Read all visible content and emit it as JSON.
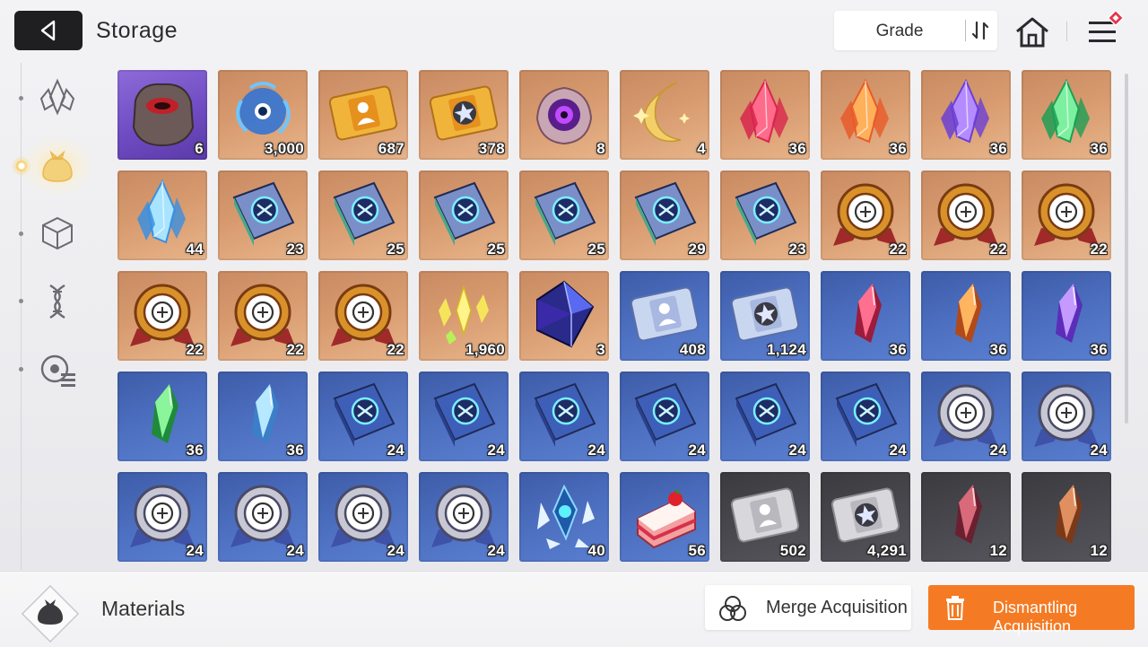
{
  "header": {
    "title": "Storage",
    "grade_label": "Grade"
  },
  "sidebar": {
    "tabs": [
      {
        "icon": "crystal-icon",
        "active": false
      },
      {
        "icon": "pouch-icon",
        "active": true
      },
      {
        "icon": "cube-icon",
        "active": false
      },
      {
        "icon": "dna-icon",
        "active": false
      },
      {
        "icon": "list-badge-icon",
        "active": false
      }
    ]
  },
  "footer": {
    "category_label": "Materials",
    "merge_label": "Merge Acquisition",
    "dismantle_label": "Dismantling Acquisition"
  },
  "colors": {
    "accent": "#f47b24",
    "grade_purple": "#7a55c8",
    "grade_orange": "#d99a6c",
    "grade_blue": "#4a6cbf",
    "grade_gray": "#45454b"
  },
  "items": [
    {
      "name": "dark-rock-item",
      "grade": "purple",
      "icon": "rock",
      "qty": "6"
    },
    {
      "name": "blue-spirit-item",
      "grade": "orange",
      "icon": "spirit",
      "qty": "3,000"
    },
    {
      "name": "gold-profile-ticket-item",
      "grade": "orange",
      "icon": "ticket-profile",
      "qty": "687"
    },
    {
      "name": "gold-star-ticket-item",
      "grade": "orange",
      "icon": "ticket-star",
      "qty": "378"
    },
    {
      "name": "eye-rock-item",
      "grade": "orange",
      "icon": "eye",
      "qty": "8"
    },
    {
      "name": "moon-feather-item",
      "grade": "orange",
      "icon": "moon",
      "qty": "4"
    },
    {
      "name": "red-crystal-item",
      "grade": "orange",
      "icon": "crystal-red",
      "qty": "36"
    },
    {
      "name": "orange-crystal-item",
      "grade": "orange",
      "icon": "crystal-orange",
      "qty": "36"
    },
    {
      "name": "purple-crystal-item",
      "grade": "orange",
      "icon": "crystal-purple",
      "qty": "36"
    },
    {
      "name": "green-crystal-item",
      "grade": "orange",
      "icon": "crystal-green",
      "qty": "36"
    },
    {
      "name": "blue-crystal-item",
      "grade": "orange",
      "icon": "crystal-blue",
      "qty": "44"
    },
    {
      "name": "sword-book-item",
      "grade": "orange",
      "icon": "book",
      "qty": "23"
    },
    {
      "name": "shield-book-item",
      "grade": "orange",
      "icon": "book",
      "qty": "25"
    },
    {
      "name": "eye-book-item",
      "grade": "orange",
      "icon": "book",
      "qty": "25"
    },
    {
      "name": "wing-book-item",
      "grade": "orange",
      "icon": "book",
      "qty": "25"
    },
    {
      "name": "bolt-book-item",
      "grade": "orange",
      "icon": "book",
      "qty": "29"
    },
    {
      "name": "target-book-item",
      "grade": "orange",
      "icon": "book",
      "qty": "23"
    },
    {
      "name": "sword-medal-item",
      "grade": "orange",
      "icon": "medal-gold",
      "qty": "22"
    },
    {
      "name": "shield-medal-item",
      "grade": "orange",
      "icon": "medal-gold",
      "qty": "22"
    },
    {
      "name": "eye-medal-item",
      "grade": "orange",
      "icon": "medal-gold",
      "qty": "22"
    },
    {
      "name": "wing-medal-item",
      "grade": "orange",
      "icon": "medal-gold",
      "qty": "22"
    },
    {
      "name": "bolt-medal-item",
      "grade": "orange",
      "icon": "medal-gold",
      "qty": "22"
    },
    {
      "name": "target-medal-item",
      "grade": "orange",
      "icon": "medal-gold",
      "qty": "22"
    },
    {
      "name": "gold-shards-item",
      "grade": "orange",
      "icon": "shards",
      "qty": "1,960"
    },
    {
      "name": "dark-cube-item",
      "grade": "orange",
      "icon": "cube",
      "qty": "3"
    },
    {
      "name": "silver-profile-ticket-item",
      "grade": "blue",
      "icon": "ticket-profile-blue",
      "qty": "408"
    },
    {
      "name": "silver-star-ticket-item",
      "grade": "blue",
      "icon": "ticket-star-blue",
      "qty": "1,124"
    },
    {
      "name": "red-shard-item",
      "grade": "blue",
      "icon": "shard-red",
      "qty": "36"
    },
    {
      "name": "orange-shard-item",
      "grade": "blue",
      "icon": "shard-orange",
      "qty": "36"
    },
    {
      "name": "purple-shard-item",
      "grade": "blue",
      "icon": "shard-purple",
      "qty": "36"
    },
    {
      "name": "green-shard-item",
      "grade": "blue",
      "icon": "shard-green",
      "qty": "36"
    },
    {
      "name": "blue-shard-item",
      "grade": "blue",
      "icon": "shard-blue",
      "qty": "36"
    },
    {
      "name": "blue-sword-book-item",
      "grade": "blue",
      "icon": "book-blue",
      "qty": "24"
    },
    {
      "name": "blue-shield-book-item",
      "grade": "blue",
      "icon": "book-blue",
      "qty": "24"
    },
    {
      "name": "blue-eye-book-item",
      "grade": "blue",
      "icon": "book-blue",
      "qty": "24"
    },
    {
      "name": "blue-wing-book-item",
      "grade": "blue",
      "icon": "book-blue",
      "qty": "24"
    },
    {
      "name": "blue-bolt-book-item",
      "grade": "blue",
      "icon": "book-blue",
      "qty": "24"
    },
    {
      "name": "blue-target-book-item",
      "grade": "blue",
      "icon": "book-blue",
      "qty": "24"
    },
    {
      "name": "silver-sword-medal-item",
      "grade": "blue",
      "icon": "medal-silver",
      "qty": "24"
    },
    {
      "name": "silver-shield-medal-item",
      "grade": "blue",
      "icon": "medal-silver",
      "qty": "24"
    },
    {
      "name": "silver-eye-medal-item",
      "grade": "blue",
      "icon": "medal-silver",
      "qty": "24"
    },
    {
      "name": "silver-wing-medal-item",
      "grade": "blue",
      "icon": "medal-silver",
      "qty": "24"
    },
    {
      "name": "silver-bolt-medal-item",
      "grade": "blue",
      "icon": "medal-silver",
      "qty": "24"
    },
    {
      "name": "silver-target-medal-item",
      "grade": "blue",
      "icon": "medal-silver",
      "qty": "24"
    },
    {
      "name": "ice-crystal-item",
      "grade": "blue",
      "icon": "ice",
      "qty": "40"
    },
    {
      "name": "strawberry-cake-item",
      "grade": "blue",
      "icon": "cake",
      "qty": "56"
    },
    {
      "name": "gray-profile-ticket-item",
      "grade": "gray",
      "icon": "ticket-profile-gray",
      "qty": "502"
    },
    {
      "name": "gray-star-ticket-item",
      "grade": "gray",
      "icon": "ticket-star-gray",
      "qty": "4,291"
    },
    {
      "name": "dull-red-shard-item",
      "grade": "gray",
      "icon": "shard-dullred",
      "qty": "12"
    },
    {
      "name": "dull-orange-shard-item",
      "grade": "gray",
      "icon": "shard-dullorange",
      "qty": "12"
    }
  ]
}
